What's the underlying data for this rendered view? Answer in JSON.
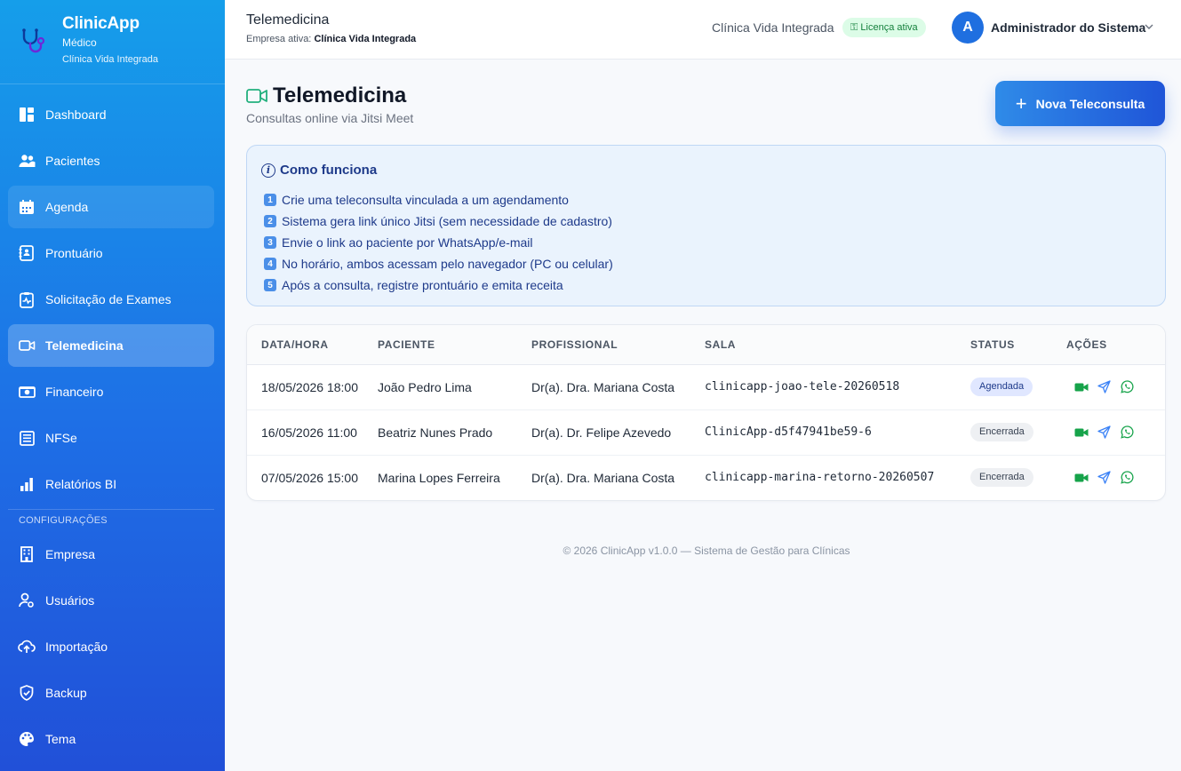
{
  "brand": {
    "app": "ClinicApp",
    "role": "Médico",
    "clinic": "Clínica Vida Integrada"
  },
  "sidebar": {
    "items": [
      {
        "label": "Dashboard",
        "icon": "dashboard-icon"
      },
      {
        "label": "Pacientes",
        "icon": "users-icon"
      },
      {
        "label": "Agenda",
        "icon": "calendar-icon"
      },
      {
        "label": "Prontuário",
        "icon": "medical-record-icon"
      },
      {
        "label": "Solicitação de Exames",
        "icon": "clipboard-pulse-icon"
      },
      {
        "label": "Telemedicina",
        "icon": "video-icon"
      },
      {
        "label": "Financeiro",
        "icon": "cash-icon"
      },
      {
        "label": "NFSe",
        "icon": "invoice-icon"
      },
      {
        "label": "Relatórios BI",
        "icon": "bar-chart-icon"
      }
    ],
    "section_label": "CONFIGURAÇÕES",
    "config_items": [
      {
        "label": "Empresa",
        "icon": "building-icon"
      },
      {
        "label": "Usuários",
        "icon": "user-gear-icon"
      },
      {
        "label": "Importação",
        "icon": "cloud-upload-icon"
      },
      {
        "label": "Backup",
        "icon": "shield-check-icon"
      },
      {
        "label": "Tema",
        "icon": "palette-icon"
      }
    ],
    "active": "Telemedicina",
    "hovered": "Agenda"
  },
  "topbar": {
    "title": "Telemedicina",
    "company_prefix": "Empresa ativa:",
    "company_name": "Clínica Vida Integrada",
    "clinic": "Clínica Vida Integrada",
    "license": "⚿ Licença ativa",
    "avatar_letter": "A",
    "user_name": "Administrador do Sistema"
  },
  "page": {
    "title": "Telemedicina",
    "subtitle": "Consultas online via Jitsi Meet",
    "new_button": "Nova Teleconsulta"
  },
  "info": {
    "title": "Como funciona",
    "steps": [
      {
        "n": "1",
        "text": "Crie uma teleconsulta vinculada a um agendamento"
      },
      {
        "n": "2",
        "text": "Sistema gera link único Jitsi (sem necessidade de cadastro)"
      },
      {
        "n": "3",
        "text": "Envie o link ao paciente por WhatsApp/e-mail"
      },
      {
        "n": "4",
        "text": "No horário, ambos acessam pelo navegador (PC ou celular)"
      },
      {
        "n": "5",
        "text": "Após a consulta, registre prontuário e emita receita"
      }
    ]
  },
  "table": {
    "columns": [
      "DATA/HORA",
      "PACIENTE",
      "PROFISSIONAL",
      "SALA",
      "STATUS",
      "AÇÕES"
    ],
    "rows": [
      {
        "datetime": "18/05/2026 18:00",
        "patient": "João Pedro Lima",
        "professional": "Dr(a). Dra. Mariana Costa",
        "room": "clinicapp-joao-tele-20260518",
        "status": "Agendada"
      },
      {
        "datetime": "16/05/2026 11:00",
        "patient": "Beatriz Nunes Prado",
        "professional": "Dr(a). Dr. Felipe Azevedo",
        "room": "ClinicApp-d5f47941be59-6",
        "status": "Encerrada"
      },
      {
        "datetime": "07/05/2026 15:00",
        "patient": "Marina Lopes Ferreira",
        "professional": "Dr(a). Dra. Mariana Costa",
        "room": "clinicapp-marina-retorno-20260507",
        "status": "Encerrada"
      }
    ]
  },
  "footer": "© 2026 ClinicApp v1.0.0 — Sistema de Gestão para Clínicas",
  "colors": {
    "accent": "#1f6fe0",
    "sidebar_top": "#159eea",
    "sidebar_bottom": "#2150d8",
    "success": "#16a34a"
  }
}
